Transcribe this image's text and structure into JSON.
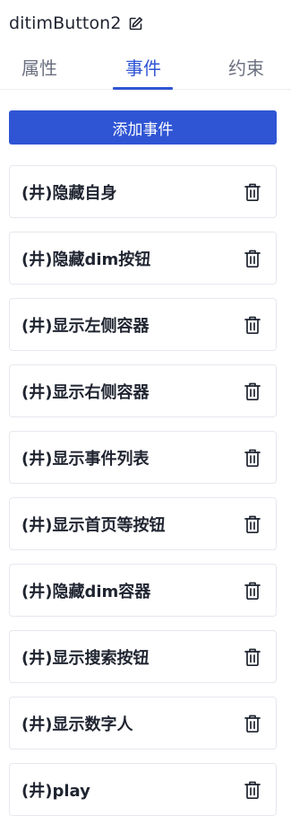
{
  "header": {
    "title": "ditimButton2",
    "edit_icon": "edit-icon"
  },
  "tabs": [
    {
      "label": "属性",
      "active": false
    },
    {
      "label": "事件",
      "active": true
    },
    {
      "label": "约束",
      "active": false
    }
  ],
  "add_button": {
    "label": "添加事件"
  },
  "events": [
    {
      "label": "(井)隐藏自身"
    },
    {
      "label": "(井)隐藏dim按钮"
    },
    {
      "label": "(井)显示左侧容器"
    },
    {
      "label": "(井)显示右侧容器"
    },
    {
      "label": "(井)显示事件列表"
    },
    {
      "label": "(井)显示首页等按钮"
    },
    {
      "label": "(井)隐藏dim容器"
    },
    {
      "label": "(井)显示搜索按钮"
    },
    {
      "label": "(井)显示数字人"
    },
    {
      "label": "(井)play"
    }
  ],
  "colors": {
    "accent": "#2f55d4",
    "text": "#1f2430",
    "muted": "#6b7080",
    "border": "#e6e8ee"
  },
  "icons": {
    "delete": "trash-icon"
  }
}
